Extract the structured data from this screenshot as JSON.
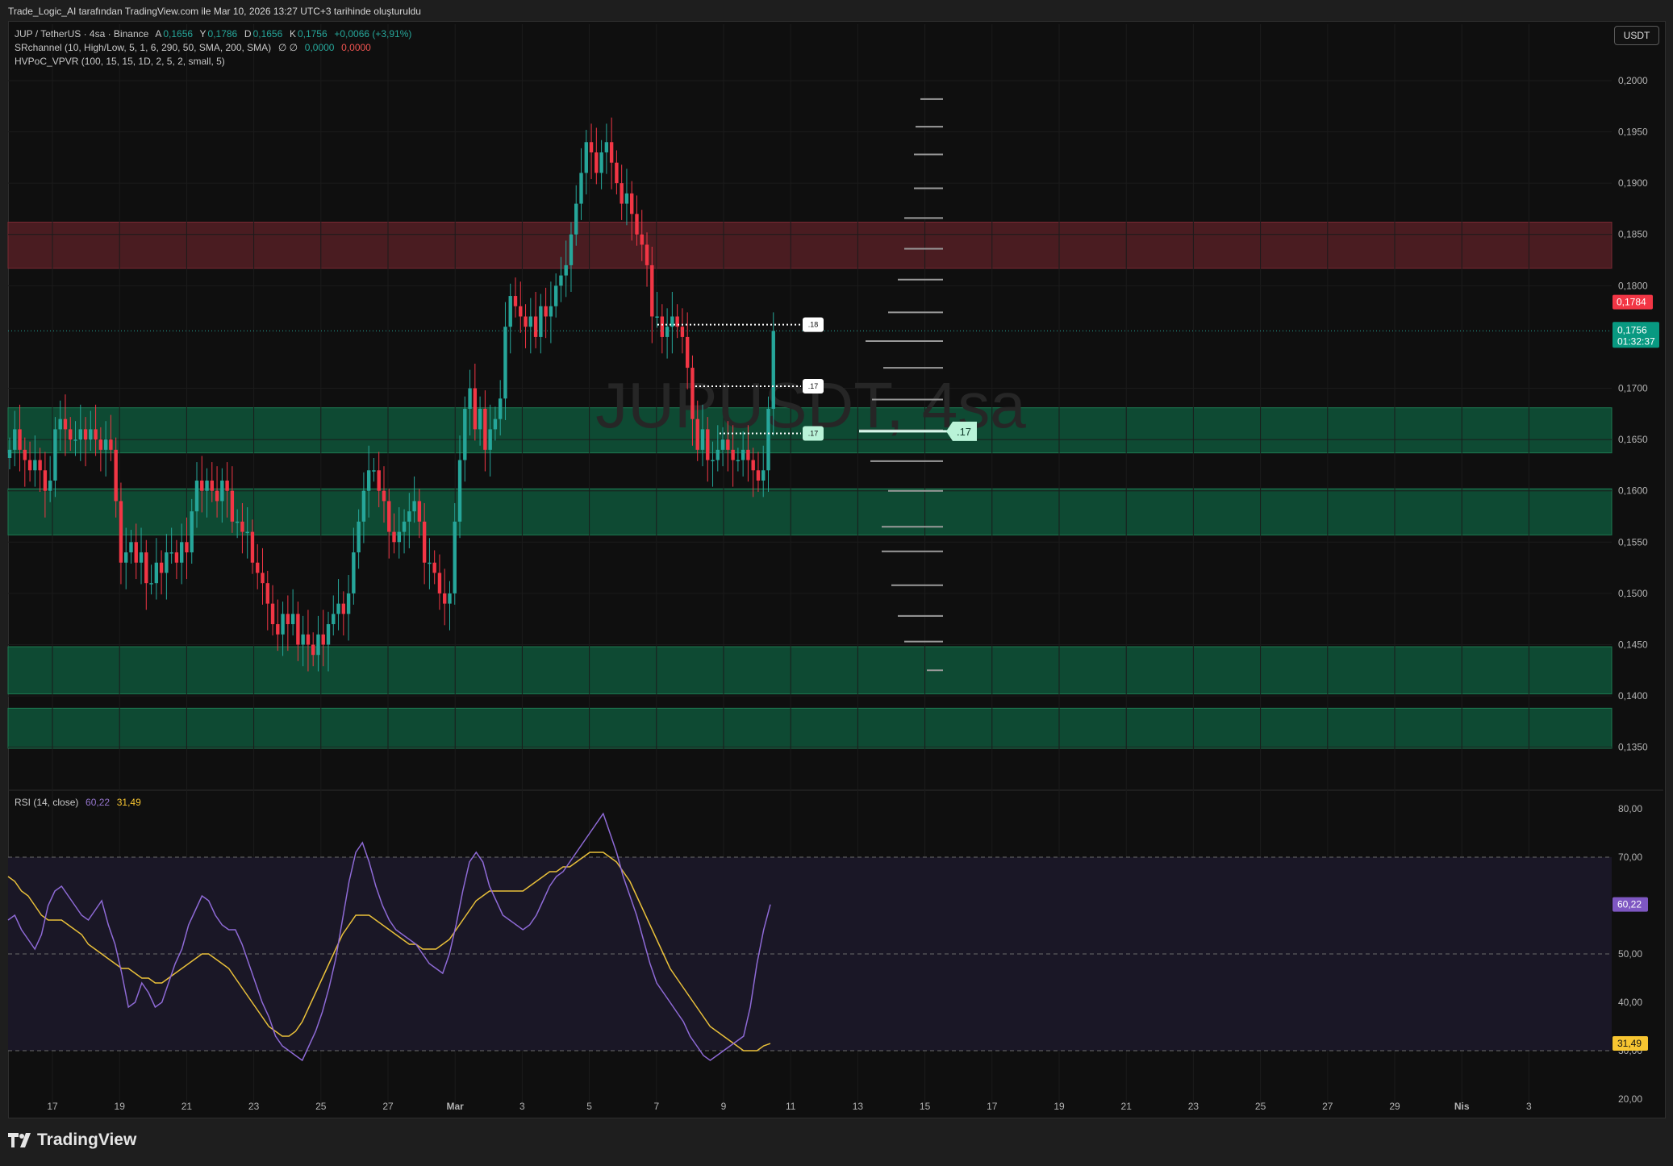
{
  "caption": "Trade_Logic_AI tarafından TradingView.com ile Mar 10, 2026 13:27 UTC+3 tarihinde oluşturuldu",
  "symbol_line": {
    "title": "JUP / TetherUS · 4sa · Binance",
    "open_label": "A",
    "open": "0,1656",
    "high_label": "Y",
    "high": "0,1786",
    "low_label": "D",
    "low": "0,1656",
    "close_label": "K",
    "close": "0,1756",
    "change": "+0,0066 (+3,91%)"
  },
  "indicators": {
    "sr": {
      "name": "SRchannel (10, High/Low, 5, 1, 6, 290, 50, SMA, 200, SMA)",
      "symbols": "∅ ∅",
      "v1": "0,0000",
      "v2": "0,0000"
    },
    "hvpoc": {
      "name": "HVPoC_VPVR (100, 15, 15, 1D, 2, 5, 2, small, 5)"
    },
    "rsi": {
      "name": "RSI (14, close)",
      "value": "60,22",
      "ma": "31,49"
    }
  },
  "currency_button": "USDT",
  "watermark": "JUPUSDT, 4sa",
  "brand": "TradingView",
  "colors": {
    "up": "#26a69a",
    "down": "#f23645",
    "rsi": "#8e6ad6",
    "rsi_ma": "#e9c03a",
    "zone_resist": "#4a1c21",
    "zone_support": "#0e4a33"
  },
  "chart_data": {
    "type": "candlestick",
    "price_axis": {
      "ticks": [
        "0,2000",
        "0,1950",
        "0,1900",
        "0,1850",
        "0,1800",
        "0,1700",
        "0,1650",
        "0,1600",
        "0,1550",
        "0,1500",
        "0,1450",
        "0,1400",
        "0,1350"
      ],
      "tick_values": [
        0.2,
        0.195,
        0.19,
        0.185,
        0.18,
        0.17,
        0.165,
        0.16,
        0.155,
        0.15,
        0.145,
        0.14,
        0.135
      ],
      "range": [
        0.1312,
        0.2055
      ],
      "last_price": "0,1756",
      "last_value": 0.1756,
      "countdown": "01:32:37",
      "high_marker": "0,1784",
      "high_marker_value": 0.1784
    },
    "time_axis": {
      "labels": [
        "17",
        "19",
        "21",
        "23",
        "25",
        "27",
        "Mar",
        "3",
        "5",
        "7",
        "9",
        "11",
        "13",
        "15",
        "17",
        "19",
        "21",
        "23",
        "25",
        "27",
        "29",
        "Nis",
        "3"
      ]
    },
    "zones": [
      {
        "kind": "resistance",
        "top": 0.1862,
        "bottom": 0.1817
      },
      {
        "kind": "support",
        "top": 0.1681,
        "bottom": 0.1637
      },
      {
        "kind": "support",
        "top": 0.1602,
        "bottom": 0.1557
      },
      {
        "kind": "support",
        "top": 0.1448,
        "bottom": 0.1402
      },
      {
        "kind": "support",
        "top": 0.1388,
        "bottom": 0.1349
      }
    ],
    "level_markers": [
      {
        "label": ".18",
        "price": 0.1762
      },
      {
        "label": ".17",
        "price": 0.1702
      },
      {
        "label": ".17",
        "price": 0.1656
      }
    ],
    "poc": {
      "label": ".17",
      "price": 0.1658
    },
    "volume_profile": [
      {
        "p": 0.1982,
        "w": 28
      },
      {
        "p": 0.1955,
        "w": 34
      },
      {
        "p": 0.1928,
        "w": 36
      },
      {
        "p": 0.1895,
        "w": 36
      },
      {
        "p": 0.1866,
        "w": 48
      },
      {
        "p": 0.1836,
        "w": 48
      },
      {
        "p": 0.1806,
        "w": 56
      },
      {
        "p": 0.1774,
        "w": 68
      },
      {
        "p": 0.1746,
        "w": 96
      },
      {
        "p": 0.172,
        "w": 74
      },
      {
        "p": 0.1689,
        "w": 88
      },
      {
        "p": 0.1659,
        "w": 104
      },
      {
        "p": 0.1629,
        "w": 90
      },
      {
        "p": 0.16,
        "w": 68
      },
      {
        "p": 0.1565,
        "w": 76
      },
      {
        "p": 0.1541,
        "w": 76
      },
      {
        "p": 0.1508,
        "w": 64
      },
      {
        "p": 0.1478,
        "w": 56
      },
      {
        "p": 0.1453,
        "w": 48
      },
      {
        "p": 0.1425,
        "w": 20
      }
    ],
    "candles_close": [
      0.164,
      0.166,
      0.164,
      0.163,
      0.162,
      0.163,
      0.162,
      0.16,
      0.161,
      0.166,
      0.167,
      0.166,
      0.165,
      0.165,
      0.166,
      0.165,
      0.166,
      0.165,
      0.164,
      0.165,
      0.164,
      0.159,
      0.153,
      0.154,
      0.155,
      0.153,
      0.154,
      0.151,
      0.151,
      0.153,
      0.152,
      0.154,
      0.154,
      0.153,
      0.155,
      0.154,
      0.158,
      0.161,
      0.16,
      0.161,
      0.16,
      0.159,
      0.161,
      0.16,
      0.157,
      0.157,
      0.156,
      0.156,
      0.153,
      0.152,
      0.151,
      0.149,
      0.147,
      0.146,
      0.148,
      0.147,
      0.148,
      0.145,
      0.146,
      0.145,
      0.144,
      0.146,
      0.145,
      0.147,
      0.148,
      0.149,
      0.148,
      0.15,
      0.154,
      0.157,
      0.16,
      0.162,
      0.162,
      0.16,
      0.159,
      0.156,
      0.155,
      0.156,
      0.157,
      0.158,
      0.159,
      0.157,
      0.153,
      0.153,
      0.152,
      0.15,
      0.149,
      0.15,
      0.157,
      0.163,
      0.168,
      0.17,
      0.166,
      0.168,
      0.164,
      0.166,
      0.167,
      0.169,
      0.176,
      0.179,
      0.178,
      0.177,
      0.176,
      0.177,
      0.175,
      0.178,
      0.177,
      0.178,
      0.18,
      0.181,
      0.182,
      0.185,
      0.188,
      0.191,
      0.194,
      0.193,
      0.191,
      0.193,
      0.194,
      0.192,
      0.19,
      0.188,
      0.189,
      0.187,
      0.185,
      0.184,
      0.182,
      0.177,
      0.177,
      0.175,
      0.176,
      0.177,
      0.176,
      0.175,
      0.172,
      0.167,
      0.164,
      0.166,
      0.163,
      0.163,
      0.164,
      0.165,
      0.164,
      0.163,
      0.163,
      0.164,
      0.163,
      0.162,
      0.161,
      0.162,
      0.168,
      0.1756
    ],
    "rsi_axis": {
      "ticks": [
        "80,00",
        "70,00",
        "50,00",
        "40,00",
        "30,00",
        "20,00"
      ],
      "tick_values": [
        80,
        70,
        50,
        40,
        30,
        20
      ],
      "range": [
        18,
        83
      ],
      "overbought": 70,
      "middle": 50,
      "oversold": 30
    },
    "rsi": [
      57,
      58,
      55,
      53,
      51,
      54,
      60,
      63,
      64,
      62,
      60,
      58,
      57,
      59,
      61,
      56,
      52,
      46,
      39,
      40,
      44,
      42,
      39,
      40,
      44,
      48,
      51,
      56,
      59,
      62,
      61,
      58,
      56,
      55,
      55,
      52,
      48,
      44,
      40,
      37,
      33,
      31,
      30,
      29,
      28,
      31,
      34,
      38,
      43,
      49,
      57,
      65,
      71,
      73,
      69,
      64,
      60,
      57,
      55,
      54,
      53,
      52,
      50,
      48,
      47,
      46,
      50,
      56,
      63,
      69,
      71,
      69,
      64,
      61,
      58,
      57,
      56,
      55,
      56,
      58,
      61,
      64,
      66,
      67,
      69,
      71,
      73,
      75,
      77,
      79,
      75,
      71,
      66,
      62,
      58,
      53,
      48,
      44,
      42,
      40,
      38,
      36,
      33,
      31,
      29,
      28,
      29,
      30,
      31,
      32,
      33,
      39,
      48,
      55,
      60.22
    ],
    "rsi_ma": [
      66,
      65,
      63,
      62,
      60,
      58,
      57,
      57,
      57,
      56,
      55,
      54,
      52,
      51,
      50,
      49,
      48,
      47,
      47,
      46,
      45,
      45,
      44,
      44,
      45,
      46,
      47,
      48,
      49,
      50,
      50,
      49,
      48,
      47,
      45,
      43,
      41,
      39,
      37,
      35,
      34,
      33,
      33,
      34,
      36,
      39,
      42,
      45,
      48,
      51,
      54,
      56,
      58,
      58,
      58,
      57,
      56,
      55,
      54,
      53,
      52,
      52,
      51,
      51,
      51,
      52,
      53,
      55,
      57,
      59,
      61,
      62,
      63,
      63,
      63,
      63,
      63,
      63,
      64,
      65,
      66,
      67,
      67,
      68,
      68,
      69,
      70,
      71,
      71,
      71,
      70,
      69,
      67,
      65,
      62,
      59,
      56,
      53,
      50,
      47,
      45,
      43,
      41,
      39,
      37,
      35,
      34,
      33,
      32,
      31,
      30,
      30,
      30,
      31,
      31.49
    ]
  }
}
